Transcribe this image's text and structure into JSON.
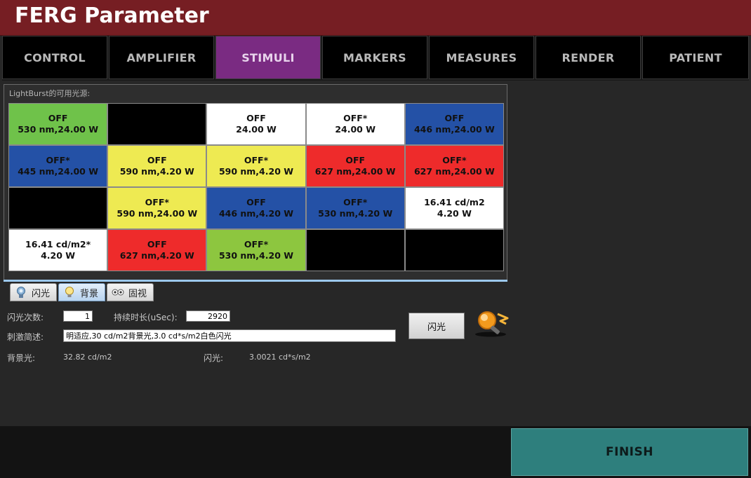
{
  "window": {
    "title": "FERG Parameter"
  },
  "tabs": [
    {
      "label": "CONTROL",
      "active": false
    },
    {
      "label": "AMPLIFIER",
      "active": false
    },
    {
      "label": "STIMULI",
      "active": true
    },
    {
      "label": "MARKERS",
      "active": false
    },
    {
      "label": "MEASURES",
      "active": false
    },
    {
      "label": "RENDER",
      "active": false
    },
    {
      "label": "PATIENT",
      "active": false
    }
  ],
  "sources": {
    "caption": "LightBurst的可用光源:",
    "rows": [
      [
        {
          "line1": "OFF",
          "line2": "530 nm,24.00 W",
          "color": "green"
        },
        {
          "line1": "",
          "line2": "",
          "color": "black"
        },
        {
          "line1": "OFF",
          "line2": "24.00 W",
          "color": "white"
        },
        {
          "line1": "OFF*",
          "line2": "24.00 W",
          "color": "white"
        },
        {
          "line1": "OFF",
          "line2": "446 nm,24.00 W",
          "color": "blue"
        }
      ],
      [
        {
          "line1": "OFF*",
          "line2": "445 nm,24.00 W",
          "color": "blue"
        },
        {
          "line1": "OFF",
          "line2": "590 nm,4.20 W",
          "color": "yellow"
        },
        {
          "line1": "OFF*",
          "line2": "590 nm,4.20 W",
          "color": "yellow"
        },
        {
          "line1": "OFF",
          "line2": "627 nm,24.00 W",
          "color": "red"
        },
        {
          "line1": "OFF*",
          "line2": "627 nm,24.00 W",
          "color": "red"
        }
      ],
      [
        {
          "line1": "",
          "line2": "",
          "color": "black"
        },
        {
          "line1": "OFF*",
          "line2": "590 nm,24.00 W",
          "color": "yellow"
        },
        {
          "line1": "OFF",
          "line2": "446 nm,4.20 W",
          "color": "blue"
        },
        {
          "line1": "OFF*",
          "line2": "530 nm,4.20 W",
          "color": "blue"
        },
        {
          "line1": "16.41 cd/m2",
          "line2": "4.20 W",
          "color": "white"
        }
      ],
      [
        {
          "line1": "16.41 cd/m2*",
          "line2": "4.20 W",
          "color": "white"
        },
        {
          "line1": "OFF",
          "line2": "627 nm,4.20 W",
          "color": "red"
        },
        {
          "line1": "OFF*",
          "line2": "530 nm,4.20 W",
          "color": "lgreen"
        },
        {
          "line1": "",
          "line2": "",
          "color": "black"
        },
        {
          "line1": "",
          "line2": "",
          "color": "black"
        }
      ]
    ]
  },
  "subtabs": [
    {
      "label": "闪光",
      "icon": "flash-lamp-icon",
      "active": false
    },
    {
      "label": "背景",
      "icon": "bulb-icon",
      "active": true
    },
    {
      "label": "固视",
      "icon": "eye-icon",
      "active": false
    }
  ],
  "form": {
    "flash_count_label": "闪光次数:",
    "flash_count_value": "1",
    "duration_label": "持续时长(uSec):",
    "duration_value": "2920",
    "description_label": "刺激简述:",
    "description_value": "明适应,30 cd/m2背景光,3.0 cd*s/m2白色闪光",
    "background_label": "背景光:",
    "background_value": "32.82 cd/m2",
    "flash_label": "闪光:",
    "flash_value": "3.0021 cd*s/m2",
    "flash_button": "闪光"
  },
  "footer": {
    "finish_label": "FINISH"
  },
  "colors": {
    "title_bg": "#761e23",
    "active_tab": "#7a2b82",
    "finish_bg": "#2e7f7d"
  }
}
